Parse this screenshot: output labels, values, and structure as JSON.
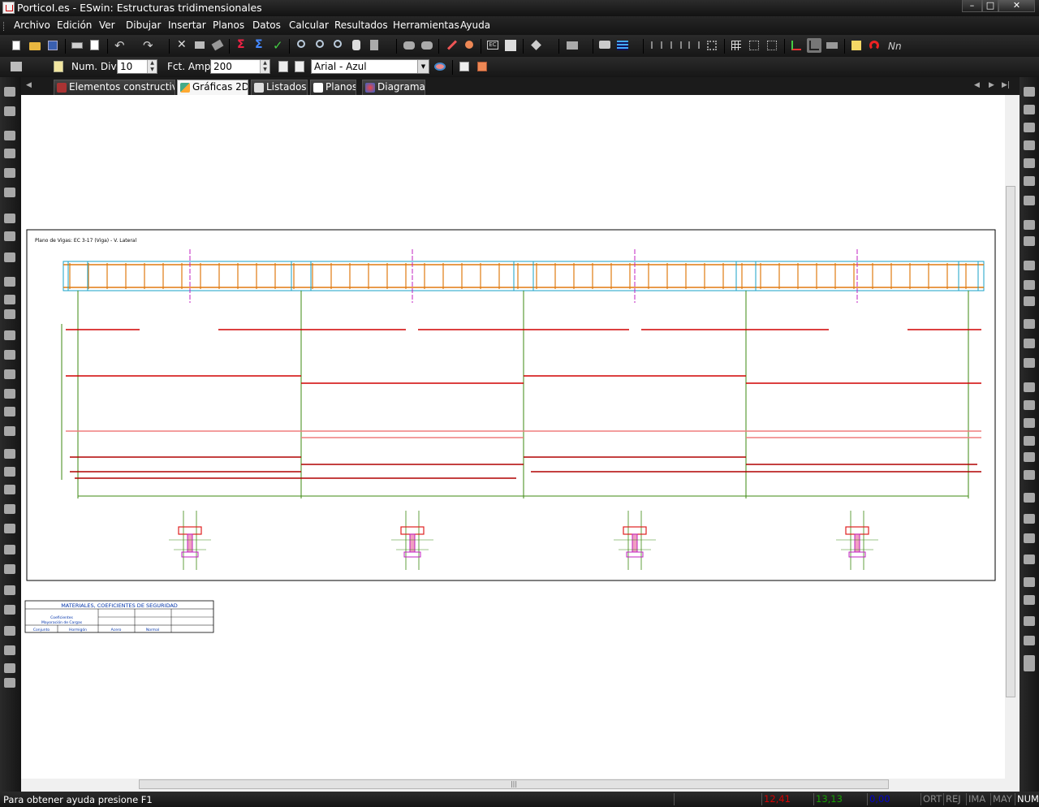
{
  "window": {
    "title": "PorticoI.es - ESwin: Estructuras tridimensionales"
  },
  "menu": [
    "Archivo",
    "Edición",
    "Ver",
    "Dibujar",
    "Insertar",
    "Planos",
    "Datos",
    "Calcular",
    "Resultados",
    "Herramientas",
    "Ayuda"
  ],
  "toolbar2": {
    "num_div_label": "Num. Div.",
    "num_div_value": "10",
    "fct_amp_label": "Fct. Amp.",
    "fct_amp_value": "200",
    "font_combo": "Arial - Azul",
    "nn_label": "Nn"
  },
  "tabs": [
    {
      "label": "Elementos constructivos",
      "active": false
    },
    {
      "label": "Gráficas 2D",
      "active": true
    },
    {
      "label": "Listados",
      "active": false
    },
    {
      "label": "Planos",
      "active": false
    },
    {
      "label": "Diagramas",
      "active": false
    }
  ],
  "drawing": {
    "plan_title": "Plano de Vigas: EC 3-17 (Viga) - V. Lateral",
    "table_title": "MATERIALES, COEFICIENTES DE SEGURIDAD",
    "table_cells": [
      "Coeficientes",
      "Mayoración de Cargas",
      "Hormigón",
      "Acero",
      "Conjunto",
      "Normal"
    ]
  },
  "status": {
    "help": "Para obtener ayuda presione F1",
    "x": "12,41",
    "y": "13,13",
    "z": "0,00",
    "flags": [
      "ORT",
      "REJ",
      "IMA",
      "MAY",
      "NUM"
    ]
  },
  "colors": {
    "x": "#d40000",
    "y": "#16a000",
    "z": "#0000d0",
    "flags_dim": "#8a8a8a",
    "flag_active": "#ffffff"
  }
}
